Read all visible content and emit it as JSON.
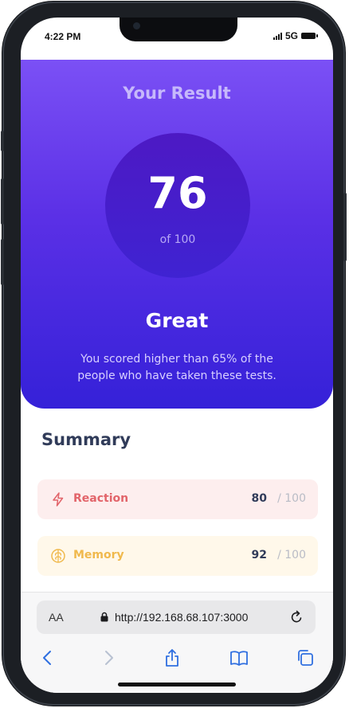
{
  "status_bar": {
    "time": "4:22 PM",
    "network": "5G"
  },
  "result": {
    "title": "Your Result",
    "score": "76",
    "out_of": "of 100",
    "rating": "Great",
    "description": "You scored higher than 65% of the people who have taken these tests."
  },
  "summary": {
    "title": "Summary",
    "items": [
      {
        "label": "Reaction",
        "score": "80",
        "max": "/ 100",
        "icon": "lightning-icon",
        "color": "#e2646a"
      },
      {
        "label": "Memory",
        "score": "92",
        "max": "/ 100",
        "icon": "brain-icon",
        "color": "#f0b94d"
      }
    ]
  },
  "browser": {
    "text_size_label": "AA",
    "url": "http://192.168.68.107:3000"
  },
  "colors": {
    "accent": "#5b30e6",
    "heading": "#303b59"
  }
}
